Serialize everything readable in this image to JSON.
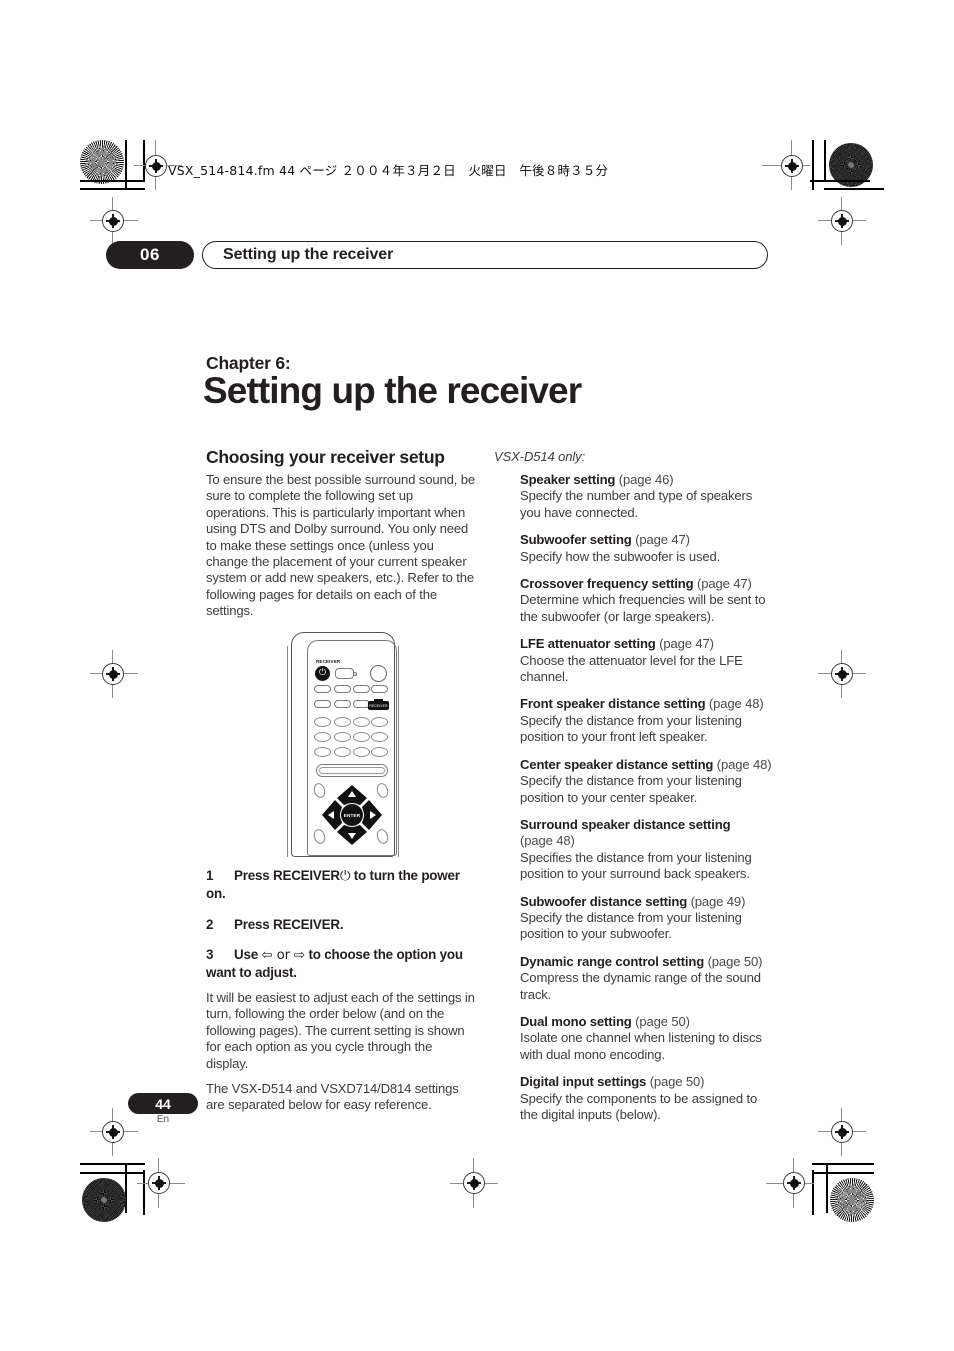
{
  "print_marks": {
    "file_info": "VSX_514-814.fm  44 ページ  ２００４年３月２日　火曜日　午後８時３５分"
  },
  "running_header": {
    "chapter_number": "06",
    "title": "Setting up the receiver"
  },
  "chapter": {
    "label": "Chapter 6:",
    "title": "Setting up the receiver"
  },
  "left_column": {
    "section_heading": "Choosing your receiver setup",
    "intro_paragraph": "To ensure the best possible surround sound, be sure to complete the following set up operations. This is particularly important when using DTS and Dolby surround. You only need to make these settings once (unless you change the placement of your current speaker system or add new speakers, etc.). Refer to the following pages for details on each of the settings.",
    "steps": [
      {
        "num": "1",
        "text_before": "Press RECEIVER",
        "glyph": "⏻",
        "text_after": " to turn the power on."
      },
      {
        "num": "2",
        "text_before": "Press RECEIVER.",
        "glyph": "",
        "text_after": ""
      },
      {
        "num": "3",
        "text_before": "Use ",
        "glyph": "⇦ or ⇨",
        "text_after": " to choose the option you want to adjust."
      }
    ],
    "after_steps_paragraph": "It will be easiest to adjust each of the settings in turn, following the order below (and on the following pages). The current setting is shown for each option as you cycle through the display.",
    "final_paragraph": "The VSX-D514 and VSXD714/D814 settings are separated below for easy reference."
  },
  "remote": {
    "receiver_label": "RECEIVER",
    "power_glyph": "⏻",
    "enter_label": "ENTER",
    "receiver_button_label": "RECEIVER"
  },
  "right_column": {
    "model_note": "VSX-D514 only:",
    "settings": [
      {
        "name": "Speaker setting",
        "page": "(page 46)",
        "desc": "Specify the number and type of speakers you have connected."
      },
      {
        "name": "Subwoofer setting",
        "page": "(page 47)",
        "desc": "Specify how the subwoofer is used."
      },
      {
        "name": "Crossover frequency setting",
        "page": "(page 47)",
        "desc": "Determine which frequencies will be sent to the subwoofer (or large speakers)."
      },
      {
        "name": "LFE attenuator setting",
        "page": "(page 47)",
        "desc": "Choose the attenuator level for the LFE channel."
      },
      {
        "name": "Front speaker distance setting",
        "page": "(page 48)",
        "desc": "Specify the distance from your listening position to your front left speaker."
      },
      {
        "name": "Center speaker distance setting",
        "page": "(page 48)",
        "desc": "Specify the distance from your listening position to your center speaker."
      },
      {
        "name": "Surround speaker distance setting",
        "page": "(page 48)",
        "desc": "Specifies the distance from your listening position to your surround back speakers."
      },
      {
        "name": "Subwoofer distance setting",
        "page": "(page 49)",
        "desc": "Specify the distance from your listening position to your subwoofer."
      },
      {
        "name": "Dynamic range control setting",
        "page": "(page 50)",
        "desc": "Compress the dynamic range of the sound track."
      },
      {
        "name": "Dual mono setting",
        "page": "(page 50)",
        "desc": "Isolate one channel when listening to discs with dual mono encoding."
      },
      {
        "name": "Digital input settings",
        "page": "(page 50)",
        "desc": "Specify the components to be assigned to the digital inputs (below)."
      }
    ]
  },
  "footer": {
    "page_number": "44",
    "language": "En"
  }
}
